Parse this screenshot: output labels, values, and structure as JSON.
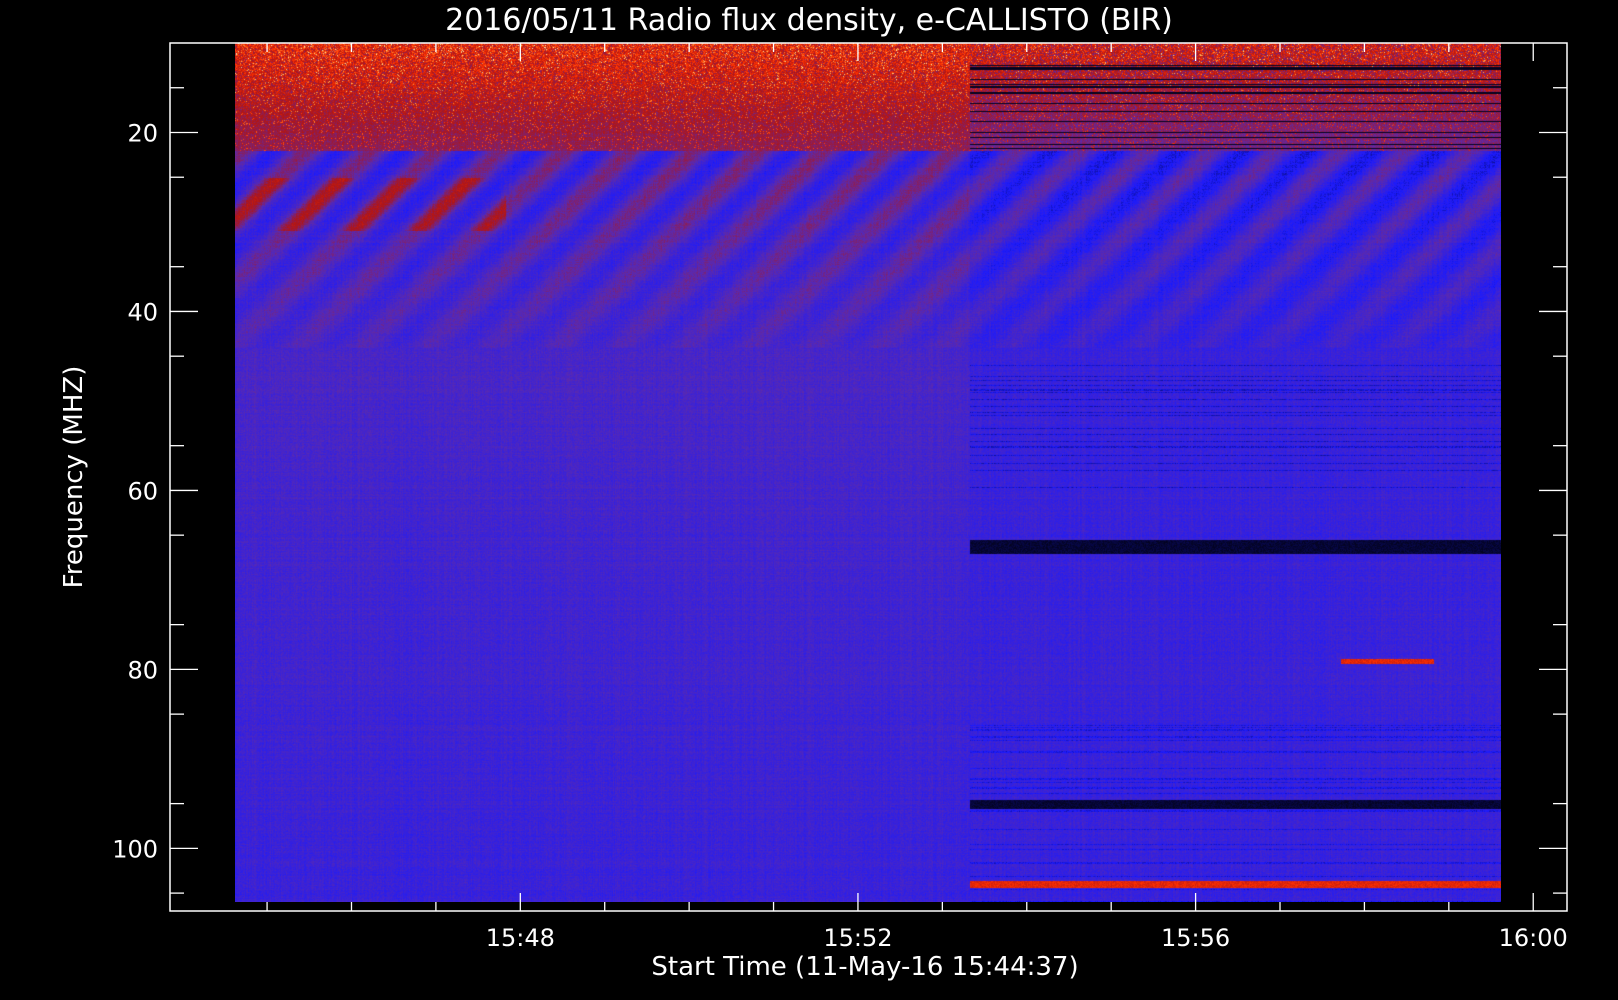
{
  "chart_data": {
    "type": "heatmap",
    "title": "2016/05/11  Radio flux density, e-CALLISTO (BIR)",
    "xlabel": "Start Time (11-May-16 15:44:37)",
    "ylabel": "Frequency (MHZ)",
    "x_tick_labels": [
      "15:48",
      "15:52",
      "15:56",
      "16:00"
    ],
    "x_tick_minutes": [
      3.383,
      7.383,
      11.383,
      15.383
    ],
    "y_tick_labels": [
      "20",
      "40",
      "60",
      "80",
      "100"
    ],
    "y_ticks": [
      20,
      40,
      60,
      80,
      100
    ],
    "xlim_minutes_from_start": [
      -0.767,
      15.783
    ],
    "ylim_mhz": [
      10,
      107
    ],
    "data_xrange_minutes": [
      0,
      15.0
    ],
    "data_yrange_mhz": [
      10,
      106
    ],
    "reverse_y": true,
    "grid": false,
    "colormap": [
      "#000000",
      "#1a1aff",
      "#5a2ab0",
      "#b01515",
      "#ff3000",
      "#ffa040",
      "#ffffc0"
    ],
    "background_color": "#000000",
    "axis_color": "#ffffff",
    "features": [
      {
        "description": "strong bright emission band at top frequencies",
        "freq_mhz": [
          10,
          22
        ],
        "time_minutes": [
          0,
          15
        ]
      },
      {
        "description": "drifting diagonal stripes (interference pattern)",
        "freq_mhz": [
          22,
          42
        ],
        "time_minutes": [
          0,
          15
        ]
      },
      {
        "description": "dark horizontal band",
        "freq_mhz": [
          65.5,
          67
        ],
        "time_minutes": [
          8.7,
          15
        ]
      },
      {
        "description": "dark horizontal band",
        "freq_mhz": [
          94.5,
          95.5
        ],
        "time_minutes": [
          8.7,
          15
        ]
      },
      {
        "description": "red narrowband emission",
        "freq_mhz": [
          103.6,
          104.4
        ],
        "time_minutes": [
          8.7,
          15
        ]
      },
      {
        "description": "red narrowband emission",
        "freq_mhz": [
          78.8,
          79.4
        ],
        "time_minutes": [
          13.1,
          14.2
        ]
      }
    ]
  }
}
